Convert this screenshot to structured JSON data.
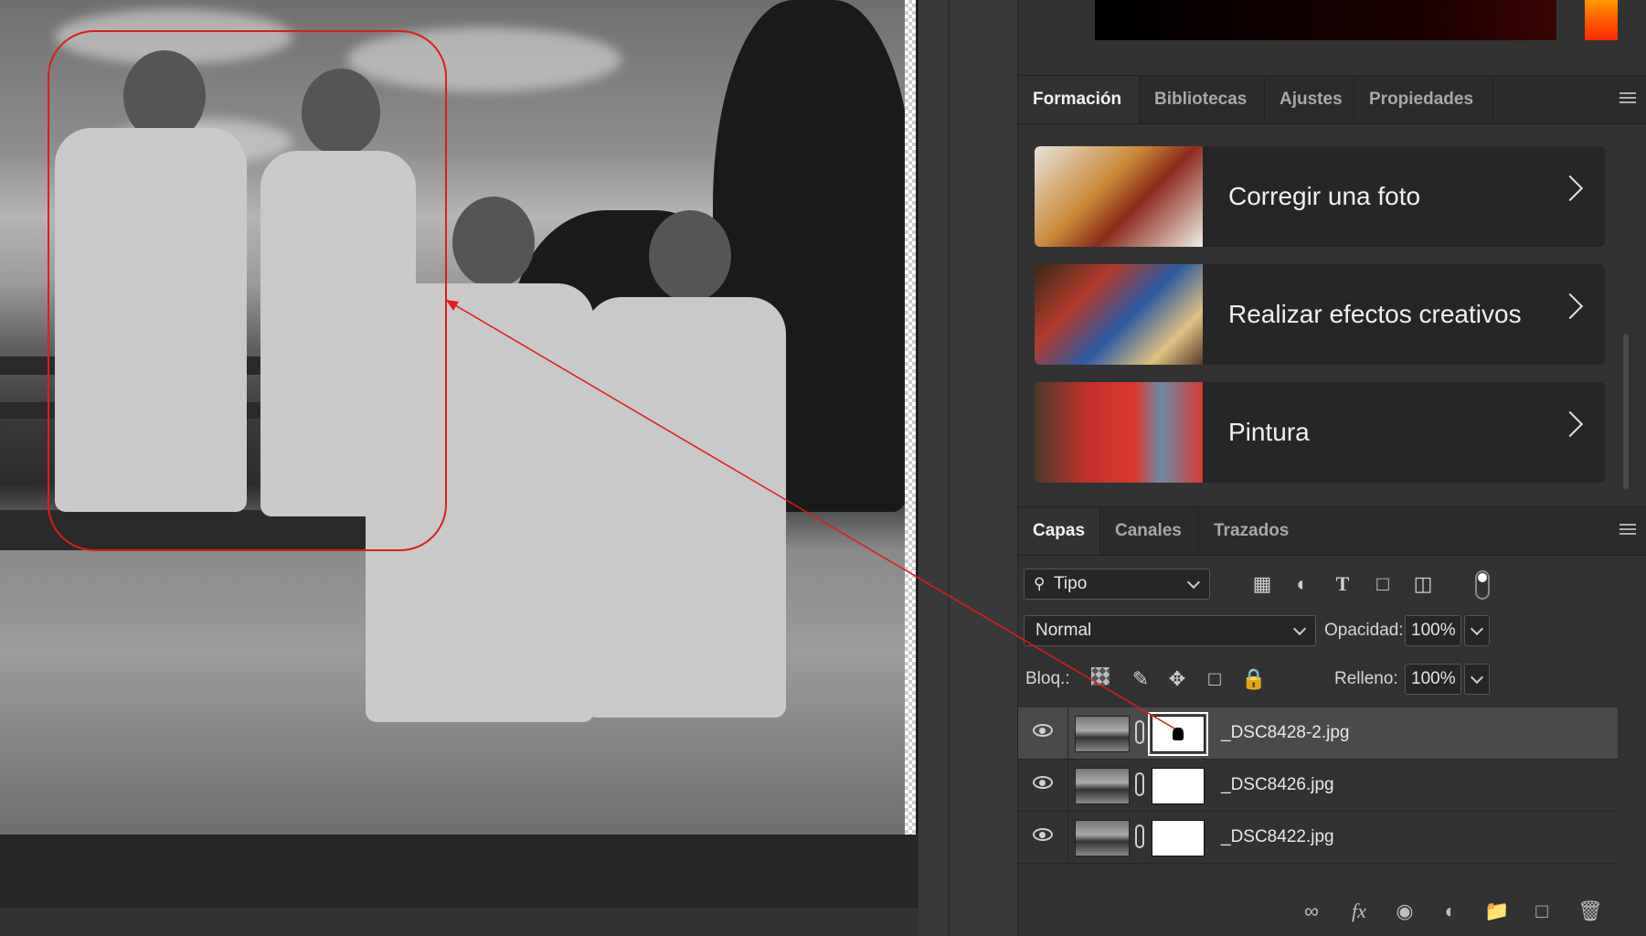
{
  "learn_panel": {
    "tabs": [
      {
        "label": "Formación",
        "active": true
      },
      {
        "label": "Bibliotecas",
        "active": false
      },
      {
        "label": "Ajustes",
        "active": false
      },
      {
        "label": "Propiedades",
        "active": false
      }
    ],
    "cards": [
      {
        "label": "Corregir una foto"
      },
      {
        "label": "Realizar efectos creativos"
      },
      {
        "label": "Pintura"
      }
    ]
  },
  "layers_panel": {
    "tabs": [
      {
        "label": "Capas",
        "active": true
      },
      {
        "label": "Canales",
        "active": false
      },
      {
        "label": "Trazados",
        "active": false
      }
    ],
    "filter": {
      "label": "Tipo",
      "icon": "search-icon"
    },
    "blend_mode": "Normal",
    "opacity": {
      "label": "Opacidad:",
      "value": "100%"
    },
    "lock": {
      "label": "Bloq.:"
    },
    "fill": {
      "label": "Relleno:",
      "value": "100%"
    },
    "layers": [
      {
        "name": "_DSC8428-2.jpg",
        "selected": true,
        "mask": "silhouette"
      },
      {
        "name": "_DSC8426.jpg",
        "selected": false,
        "mask": "white"
      },
      {
        "name": "_DSC8422.jpg",
        "selected": false,
        "mask": "white"
      }
    ]
  },
  "colors": {
    "annotation": "#e01b1b",
    "panel_bg": "#323232",
    "selected_layer": "#4a4a4a"
  }
}
